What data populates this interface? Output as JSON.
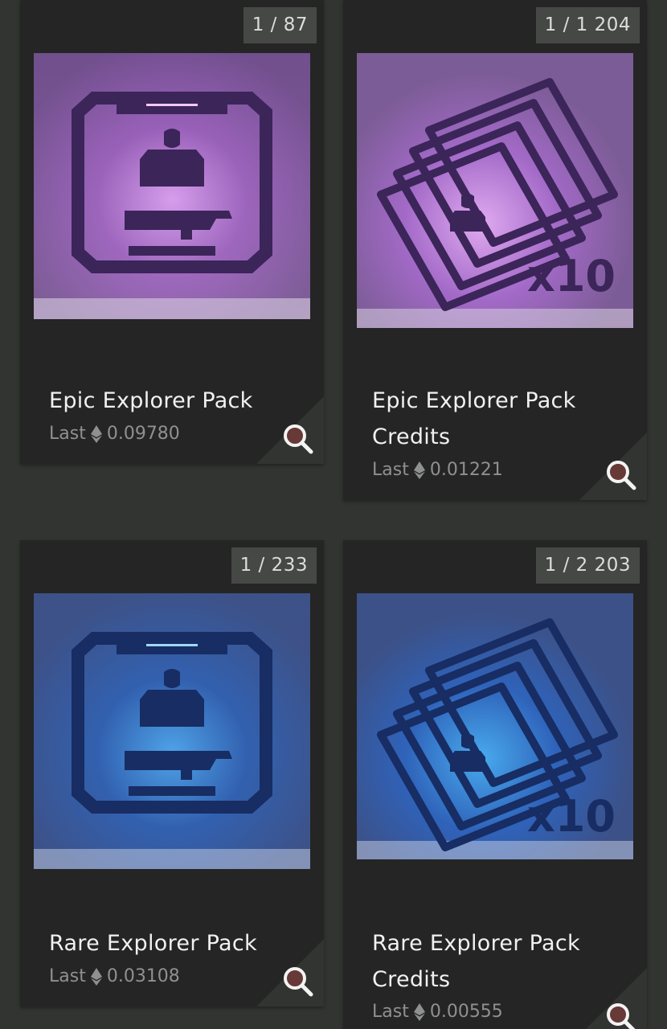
{
  "cards": [
    {
      "count": "1 / 87",
      "title": "Epic Explorer Pack",
      "price_label": "Last",
      "price": "0.09780",
      "theme": "purple",
      "kind": "pack"
    },
    {
      "count": "1 / 1 204",
      "title": "Epic Explorer Pack Credits",
      "price_label": "Last",
      "price": "0.01221",
      "theme": "purple",
      "kind": "credits",
      "multiplier": "x10"
    },
    {
      "count": "1 / 233",
      "title": "Rare Explorer Pack",
      "price_label": "Last",
      "price": "0.03108",
      "theme": "blue",
      "kind": "pack"
    },
    {
      "count": "1 / 2 203",
      "title": "Rare Explorer Pack Credits",
      "price_label": "Last",
      "price": "0.00555",
      "theme": "blue",
      "kind": "credits",
      "multiplier": "x10"
    }
  ],
  "colors": {
    "background": "#323431",
    "card": "#242524",
    "badge": "#464846",
    "purple_glow": "#d88cf5",
    "blue_glow": "#3aa7ff"
  },
  "icons": {
    "currency": "ethereum-icon",
    "action": "zoom-magnifier-icon"
  }
}
